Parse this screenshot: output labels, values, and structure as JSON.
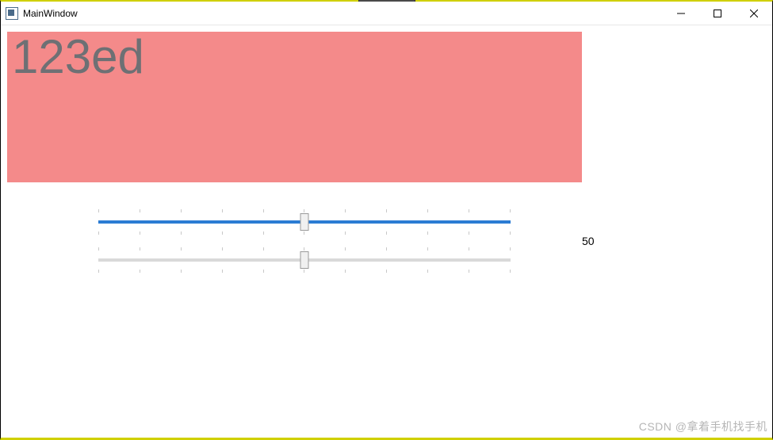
{
  "window": {
    "title": "MainWindow"
  },
  "content": {
    "textbox_value": "123ed",
    "slider1": {
      "value": 50,
      "min": 0,
      "max": 100
    },
    "slider2": {
      "value": 50,
      "min": 0,
      "max": 100
    },
    "value_label": "50"
  },
  "watermark": "CSDN @拿着手机找手机"
}
